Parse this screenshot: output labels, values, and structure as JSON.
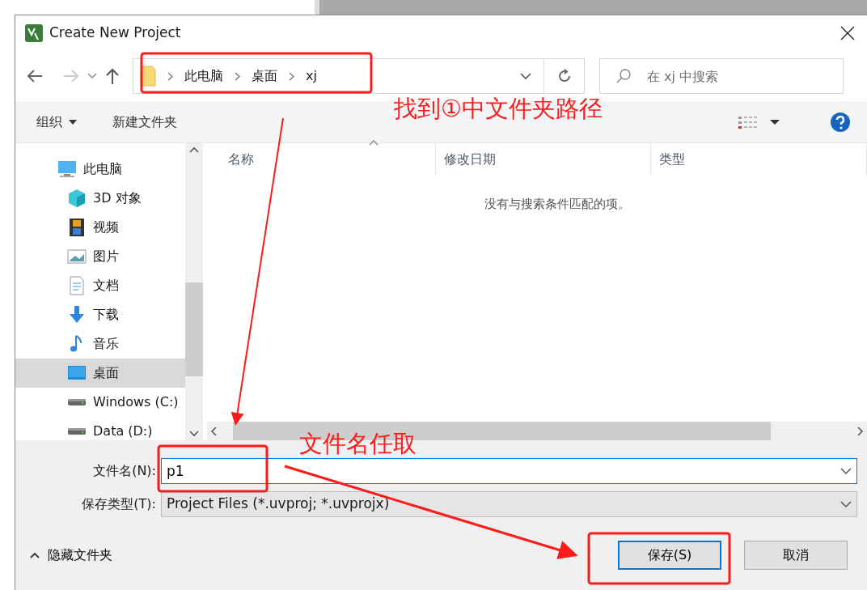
{
  "window": {
    "title": "Create New Project"
  },
  "address_bar": {
    "path": [
      "此电脑",
      "桌面",
      "xj"
    ]
  },
  "search": {
    "placeholder": "在 xj 中搜索"
  },
  "toolbar": {
    "organize": "组织",
    "new_folder": "新建文件夹"
  },
  "sidebar": {
    "items": [
      {
        "label": "此电脑",
        "kind": "computer",
        "selected": false,
        "children": [
          {
            "label": "3D 对象",
            "kind": "cube",
            "selected": false
          },
          {
            "label": "视频",
            "kind": "video",
            "selected": false
          },
          {
            "label": "图片",
            "kind": "image",
            "selected": false
          },
          {
            "label": "文档",
            "kind": "document",
            "selected": false
          },
          {
            "label": "下载",
            "kind": "download",
            "selected": false
          },
          {
            "label": "音乐",
            "kind": "music",
            "selected": false
          },
          {
            "label": "桌面",
            "kind": "desktop",
            "selected": true
          },
          {
            "label": "Windows (C:)",
            "kind": "drive",
            "selected": false
          },
          {
            "label": "Data (D:)",
            "kind": "drive",
            "selected": false
          }
        ]
      }
    ]
  },
  "columns": [
    {
      "label": "名称",
      "sorted": true
    },
    {
      "label": "修改日期",
      "sorted": false
    },
    {
      "label": "类型",
      "sorted": false
    }
  ],
  "empty_message": "没有与搜索条件匹配的项。",
  "filename": {
    "label": "文件名(N):",
    "value": "p1"
  },
  "filetype": {
    "label": "保存类型(T):",
    "value": "Project Files (*.uvproj; *.uvprojx)"
  },
  "hide_folders": "隐藏文件夹",
  "buttons": [
    {
      "label": "保存(S)",
      "default": true
    },
    {
      "label": "取消",
      "default": false
    }
  ],
  "annotations": [
    {
      "text": "找到①中文件夹路径"
    },
    {
      "text": "文件名任取"
    }
  ]
}
